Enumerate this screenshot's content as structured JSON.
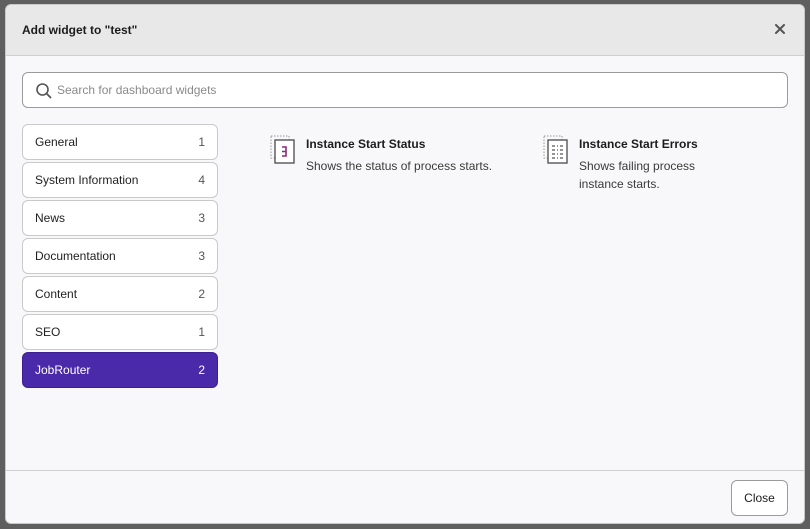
{
  "modal": {
    "title": "Add widget to \"test\"",
    "close_icon": "close-icon"
  },
  "search": {
    "placeholder": "Search for dashboard widgets",
    "value": "",
    "icon": "search-icon"
  },
  "categories": [
    {
      "label": "General",
      "count": "1"
    },
    {
      "label": "System Information",
      "count": "4"
    },
    {
      "label": "News",
      "count": "3"
    },
    {
      "label": "Documentation",
      "count": "3"
    },
    {
      "label": "Content",
      "count": "2"
    },
    {
      "label": "SEO",
      "count": "1"
    },
    {
      "label": "JobRouter",
      "count": "2",
      "active": true
    }
  ],
  "widgets": [
    {
      "title": "Instance Start Status",
      "description": "Shows the status of process starts.",
      "icon": "status-widget-icon"
    },
    {
      "title": "Instance Start Errors",
      "description": "Shows failing process instance starts.",
      "icon": "errors-widget-icon"
    }
  ],
  "footer": {
    "close_label": "Close"
  },
  "colors": {
    "accent": "#4a2aa8",
    "overlay": "#5f5f5f"
  }
}
